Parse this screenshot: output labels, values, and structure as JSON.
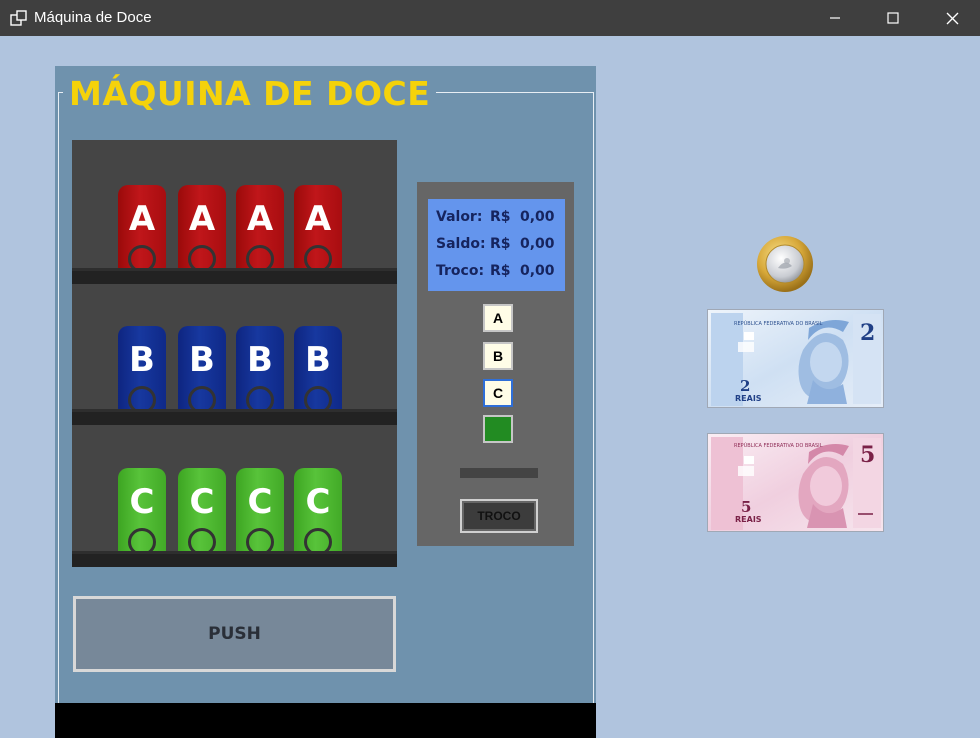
{
  "window": {
    "title": "Máquina de Doce",
    "app_icon": "window-icon",
    "controls": [
      "minimize-icon",
      "maximize-icon",
      "close-icon"
    ]
  },
  "machine": {
    "title": "MÁQUINA DE DOCE",
    "title_color": "#f5d20a",
    "shelves": [
      {
        "label": "A",
        "color": "#c0161a",
        "count": 4
      },
      {
        "label": "B",
        "color": "#17389f",
        "count": 4
      },
      {
        "label": "C",
        "color": "#58c33a",
        "count": 4
      }
    ],
    "push_label": "PUSH"
  },
  "panel": {
    "display": {
      "valor_label": "Valor:",
      "valor_currency": "R$",
      "valor_value": "0,00",
      "saldo_label": "Saldo:",
      "saldo_currency": "R$",
      "saldo_value": "0,00",
      "troco_label": "Troco:",
      "troco_currency": "R$",
      "troco_value": "0,00"
    },
    "selection_buttons": [
      "A",
      "B",
      "C"
    ],
    "selected": "C",
    "confirm_color": "#228b22",
    "troco_button_label": "TROCO"
  },
  "money": {
    "coin": "one-real-coin",
    "notes": [
      {
        "value": "2",
        "label": "REAIS",
        "header": "REPÚBLICA FEDERATIVA DO BRASIL",
        "color": "#5b8fd0"
      },
      {
        "value": "5",
        "label": "REAIS",
        "header": "REPÚBLICA FEDERATIVA DO BRASIL",
        "color": "#c0507a"
      }
    ]
  }
}
